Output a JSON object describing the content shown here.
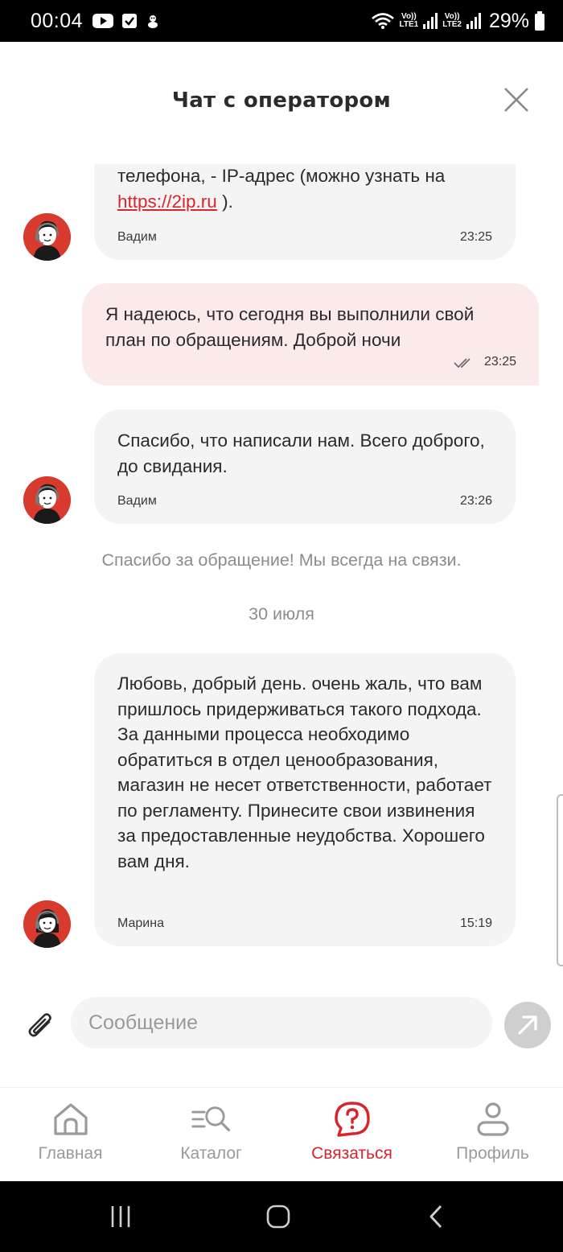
{
  "status_bar": {
    "time": "00:04",
    "battery": "29%",
    "sim1": [
      "Vo))",
      "LTE1"
    ],
    "sim2": [
      "Vo))",
      "LTE2"
    ]
  },
  "header": {
    "title": "Чат с оператором"
  },
  "messages": [
    {
      "from": "operator",
      "text_before_link": "телефона, - IP-адрес (можно узнать на ",
      "link": "https://2ip.ru",
      "text_after_link": " ).",
      "name": "Вадим",
      "time": "23:25"
    },
    {
      "from": "me",
      "text": "Я надеюсь, что сегодня вы выполнили свой план по обращениям. Доброй ночи",
      "time": "23:25",
      "status": "read"
    },
    {
      "from": "operator",
      "text": "Спасибо, что написали нам. Всего доброго, до свидания.",
      "name": "Вадим",
      "time": "23:26"
    },
    {
      "from": "operator",
      "text": "Любовь, добрый день. очень жаль, что вам пришлось придерживаться такого подхода. За данными процесса необходимо обратиться в отдел ценообразования, магазин не несет ответственности, работает по регламенту. Принесите свои извинения за предоставленные неудобства. Хорошего вам дня.",
      "name": "Марина",
      "time": "15:19"
    }
  ],
  "system_note": "Спасибо за обращение! Мы всегда на связи.",
  "date_separator": "30 июля",
  "composer": {
    "placeholder": "Сообщение"
  },
  "nav": {
    "items": [
      {
        "label": "Главная",
        "icon": "home-icon",
        "active": false
      },
      {
        "label": "Каталог",
        "icon": "catalog-search-icon",
        "active": false
      },
      {
        "label": "Связаться",
        "icon": "help-chat-icon",
        "active": true
      },
      {
        "label": "Профиль",
        "icon": "profile-icon",
        "active": false
      }
    ]
  },
  "colors": {
    "accent": "#d6262b",
    "operator_bubble": "#f4f4f4",
    "my_bubble": "#fbeaea",
    "avatar_bg": "#d83a2e"
  }
}
